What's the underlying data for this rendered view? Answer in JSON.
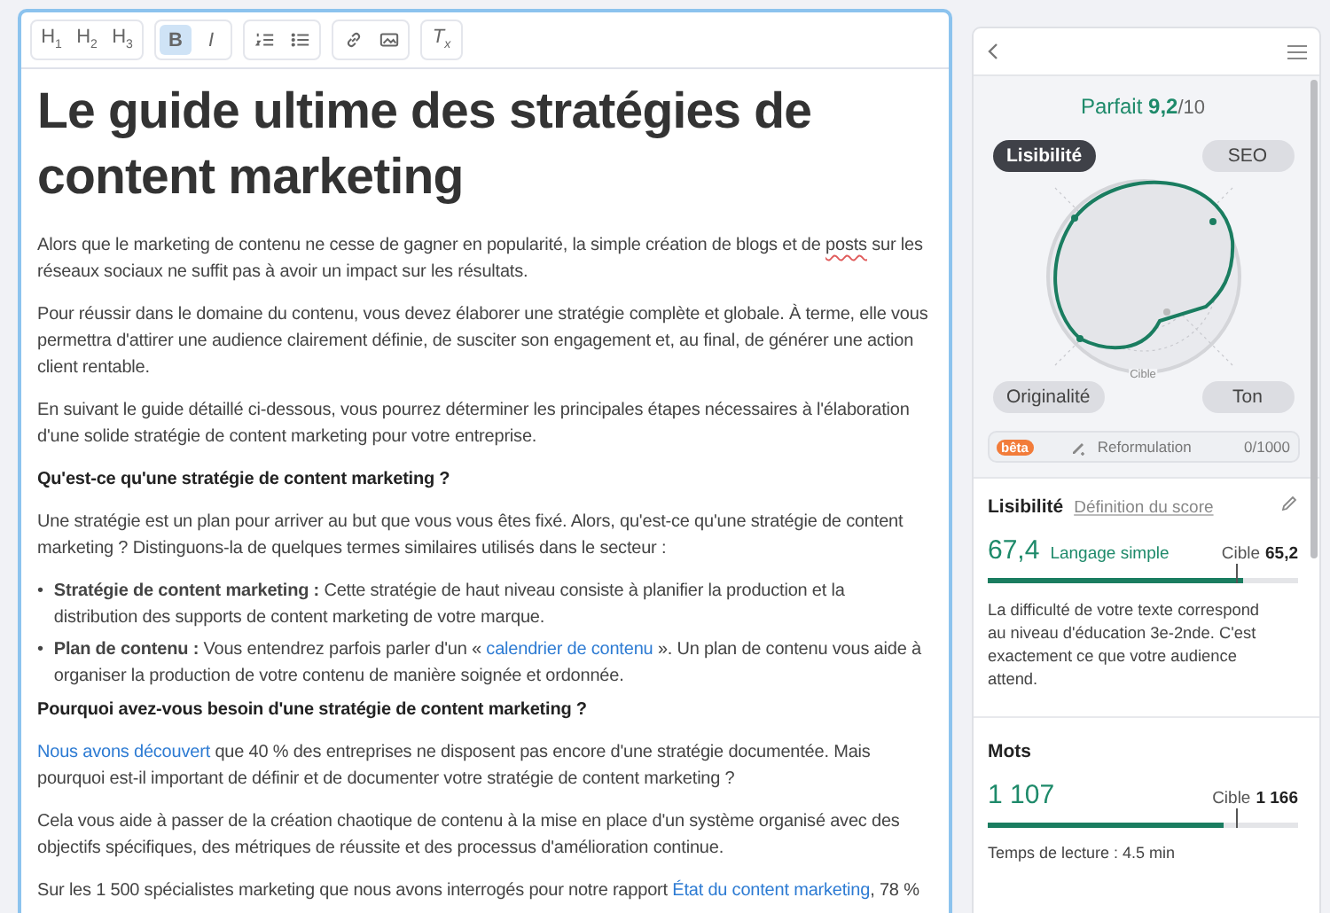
{
  "toolbar": [
    {
      "kind": "h1",
      "label": "H$_{1}$",
      "active": false
    },
    {
      "kind": "h2",
      "label": "H$_{2}$",
      "active": false
    },
    {
      "kind": "h3",
      "label": "H$_{3}$",
      "active": false
    },
    {
      "kind": "bold",
      "label": "B",
      "active": true
    },
    {
      "kind": "italic",
      "label": "I",
      "active": false
    },
    {
      "kind": "ordered-list",
      "active": false
    },
    {
      "kind": "bullet-list",
      "active": false
    },
    {
      "kind": "link",
      "active": false
    },
    {
      "kind": "image",
      "active": false
    },
    {
      "kind": "clear-format",
      "label": "T$_{x}$",
      "active": false
    }
  ],
  "content": [
    {
      "kind": "title",
      "text": "Le guide ultime des stratégies de content marketing"
    },
    {
      "kind": "paragraph",
      "parts": [
        {
          "kind": "text",
          "text": "Alors que le marketing de contenu ne cesse de gagner en popularité, la simple création de blogs et de"
        },
        {
          "kind": "flagged",
          "text": "posts"
        },
        {
          "kind": "text",
          "text": "sur les réseaux sociaux ne suffit pas à avoir un impact sur les résultats."
        }
      ]
    },
    {
      "kind": "paragraph",
      "parts": [
        {
          "kind": "text",
          "text": "Pour réussir dans le domaine du contenu, vous devez élaborer une stratégie complète et globale. À terme, elle vous permettra d'attirer une audience clairement définie, de susciter son engagement et, au final, de générer une action client rentable."
        }
      ]
    },
    {
      "kind": "paragraph",
      "parts": [
        {
          "kind": "text",
          "text": "En suivant le guide détaillé ci-dessous, vous pourrez déterminer les principales étapes nécessaires à l'élaboration d'une solide stratégie de content marketing pour votre entreprise."
        }
      ]
    },
    {
      "kind": "heading",
      "text": "Qu'est-ce qu'une stratégie de content marketing ?"
    },
    {
      "kind": "paragraph",
      "parts": [
        {
          "kind": "text",
          "text": "Une stratégie est un plan pour arriver au but que vous vous êtes fixé. Alors, qu'est-ce qu'une stratégie de content marketing ? Distinguons-la de quelques termes similaires utilisés dans le secteur :"
        }
      ]
    },
    {
      "kind": "list",
      "items": [
        {
          "marker": "•",
          "parts": [
            {
              "kind": "text",
              "text": "**Stratégie de content marketing :** Cette stratégie de haut niveau consiste à planifier la production et la distribution des supports de content marketing de votre marque."
            }
          ]
        },
        {
          "marker": "•",
          "parts": [
            {
              "kind": "text",
              "text": "**Plan de contenu :** Vous entendrez parfois parler d'un «"
            },
            {
              "kind": "link",
              "text": "calendrier de contenu"
            },
            {
              "kind": "text",
              "text": "». Un plan de contenu vous aide à organiser la production de votre contenu de manière soignée et ordonnée."
            }
          ]
        }
      ]
    },
    {
      "kind": "heading",
      "text": "Pourquoi avez-vous besoin d'une stratégie de content marketing ?"
    },
    {
      "kind": "paragraph",
      "parts": [
        {
          "kind": "link",
          "text": "Nous avons découvert"
        },
        {
          "kind": "text",
          "text": "que 40 % des entreprises ne disposent pas encore d'une stratégie documentée. Mais pourquoi est-il important de définir et de documenter votre stratégie de content marketing ?"
        }
      ]
    },
    {
      "kind": "paragraph",
      "parts": [
        {
          "kind": "text",
          "text": "Cela vous aide à passer de la création chaotique de contenu à la mise en place d'un système organisé avec des objectifs spécifiques, des métriques de réussite et des processus d'amélioration continue."
        }
      ]
    },
    {
      "kind": "paragraph",
      "parts": [
        {
          "kind": "text",
          "text": "Sur les 1 500 spécialistes marketing que nous avons interrogés pour notre rapport"
        },
        {
          "kind": "link",
          "text": "État du content marketing"
        },
        {
          "kind": "text",
          "text": ", 78 %"
        }
      ]
    }
  ],
  "panel": {
    "score": {
      "label": "Parfait",
      "value": "9,2",
      "max": "/10"
    },
    "tabs": [
      {
        "label": "Lisibilité",
        "selected": true
      },
      {
        "label": "SEO",
        "selected": false
      },
      {
        "label": "Originalité",
        "selected": false
      },
      {
        "label": "Ton",
        "selected": false
      }
    ],
    "radar_label": "Cible",
    "rephrase": {
      "badge": "bêta",
      "label": "Reformulation",
      "count": "0/1000"
    },
    "readability": {
      "title": "Lisibilité",
      "link": "Définition du score",
      "score": "67,4",
      "verdict": "Langage simple",
      "target_label": "Cible",
      "target": "65,2",
      "bar": {
        "level": 0.82
      },
      "target_mark": {
        "level": 0.8
      },
      "description": "La difficulté de votre texte correspond au niveau d'éducation 3e-2nde. C'est exactement ce que votre audience attend."
    },
    "words": {
      "title": "Mots",
      "count": "1 107",
      "target_label": "Cible",
      "target": "1 166",
      "bar": {
        "level": 0.76
      },
      "target_mark": {
        "level": 0.8
      },
      "reading_time": "Temps de lecture : 4.5 min"
    }
  }
}
